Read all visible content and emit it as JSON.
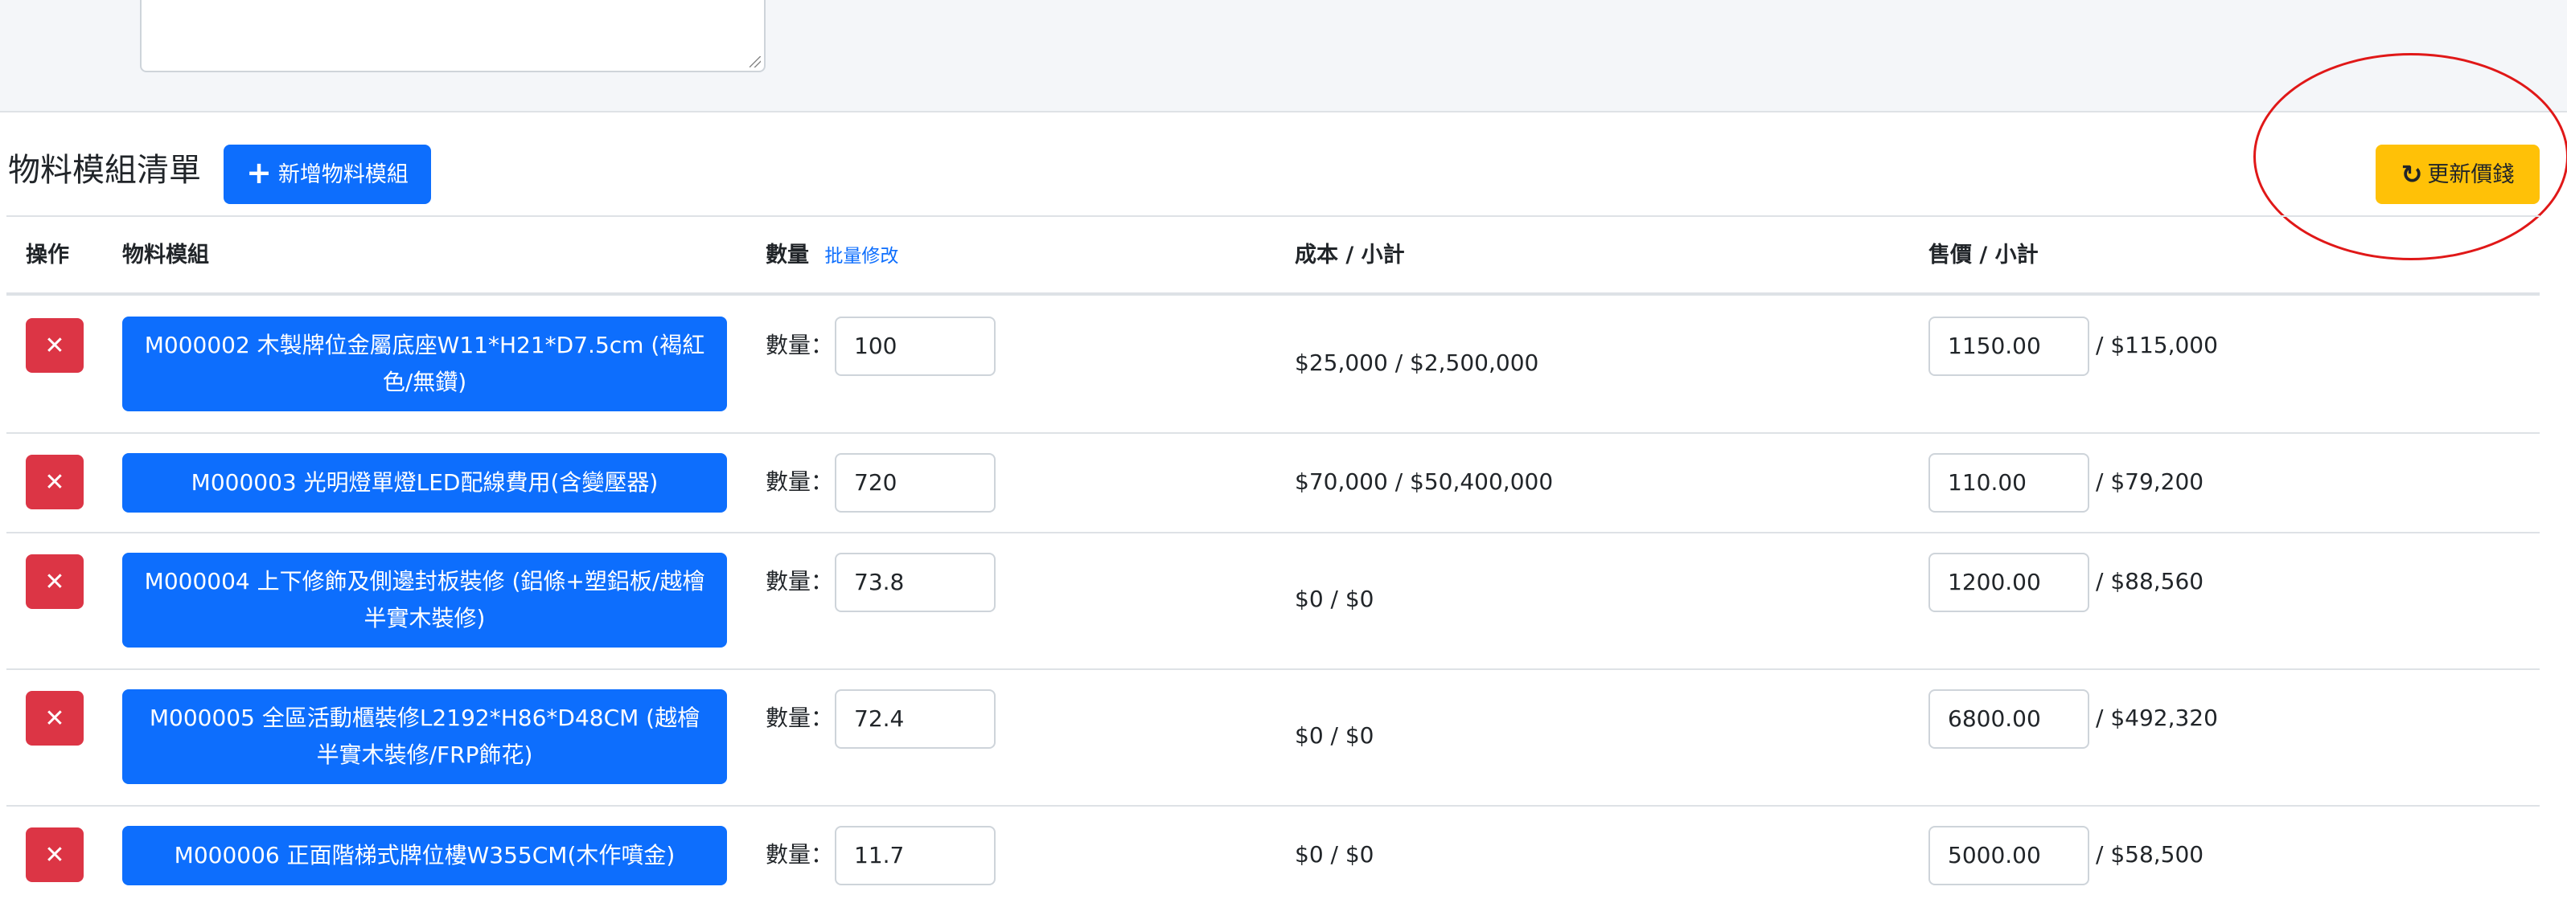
{
  "section": {
    "title": "物料模組清單",
    "add_button": "新增物料模組",
    "update_button": "更新價錢"
  },
  "table": {
    "headers": {
      "action": "操作",
      "module": "物料模組",
      "quantity": "數量",
      "batch_edit": "批量修改",
      "cost": "成本 / 小計",
      "price": "售價 / 小計"
    },
    "rows": [
      {
        "name": "M000002 木製牌位金屬底座W11*H21*D7.5cm (褐紅色/無鑽)",
        "qty_label": "數量：",
        "qty": "100",
        "cost": "$25,000 / $2,500,000",
        "price": "1150.00",
        "subtotal": "/ $115,000"
      },
      {
        "name": "M000003 光明燈單燈LED配線費用(含變壓器)",
        "qty_label": "數量：",
        "qty": "720",
        "cost": "$70,000 / $50,400,000",
        "price": "110.00",
        "subtotal": "/ $79,200"
      },
      {
        "name": "M000004 上下修飾及側邊封板裝修 (鋁條+塑鋁板/越檜半實木裝修)",
        "qty_label": "數量：",
        "qty": "73.8",
        "cost": "$0 / $0",
        "price": "1200.00",
        "subtotal": "/ $88,560"
      },
      {
        "name": "M000005 全區活動櫃裝修L2192*H86*D48CM (越檜半實木裝修/FRP飾花)",
        "qty_label": "數量：",
        "qty": "72.4",
        "cost": "$0 / $0",
        "price": "6800.00",
        "subtotal": "/ $492,320"
      },
      {
        "name": "M000006 正面階梯式牌位樓W355CM(木作噴金)",
        "qty_label": "數量：",
        "qty": "11.7",
        "cost": "$0 / $0",
        "price": "5000.00",
        "subtotal": "/ $58,500"
      }
    ]
  },
  "colors": {
    "primary": "#0d6efd",
    "danger": "#dc3545",
    "warning": "#ffc107",
    "annotation": "#e01818"
  }
}
